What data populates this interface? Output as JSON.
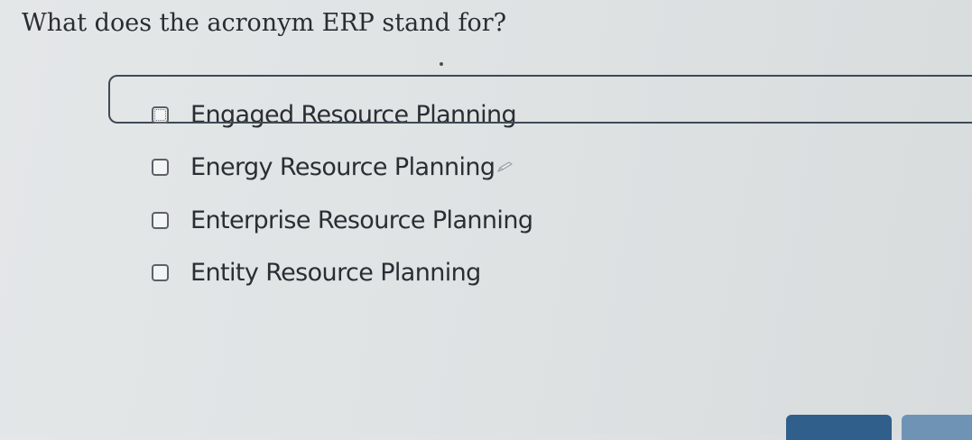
{
  "question": {
    "text": "What does the acronym ERP stand for?"
  },
  "options": [
    {
      "label": "Engaged Resource Planning",
      "checked": false,
      "focused": true
    },
    {
      "label": "Energy Resource Planning",
      "checked": false,
      "focused": false
    },
    {
      "label": "Enterprise Resource Planning",
      "checked": false,
      "focused": false
    },
    {
      "label": "Entity Resource Planning",
      "checked": false,
      "focused": false
    }
  ],
  "icons": {
    "cursor_icon": "pencil-icon"
  },
  "colors": {
    "primary_button": "#2f5f8a",
    "secondary_button": "#6f93b5",
    "focus_outline": "#3f4a54"
  }
}
